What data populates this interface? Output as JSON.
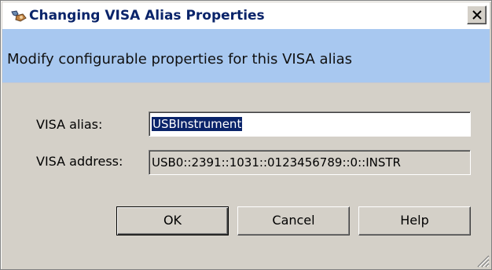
{
  "dialog": {
    "title": "Changing VISA Alias Properties",
    "subtitle": "Modify configurable properties for this VISA alias"
  },
  "form": {
    "alias_label": "VISA alias:",
    "alias_value": "USBInstrument",
    "address_label": "VISA address:",
    "address_value": "USB0::2391::1031::0123456789::0::INSTR"
  },
  "buttons": {
    "ok": "OK",
    "cancel": "Cancel",
    "help": "Help"
  },
  "icons": {
    "title_icon": "visa-properties-icon",
    "close": "close-icon",
    "resize": "resize-grip-icon"
  },
  "colors": {
    "title_text": "#0a246a",
    "banner": "#a8c8f0",
    "dialog_face": "#d4d0c8",
    "selection": "#0a246a"
  }
}
